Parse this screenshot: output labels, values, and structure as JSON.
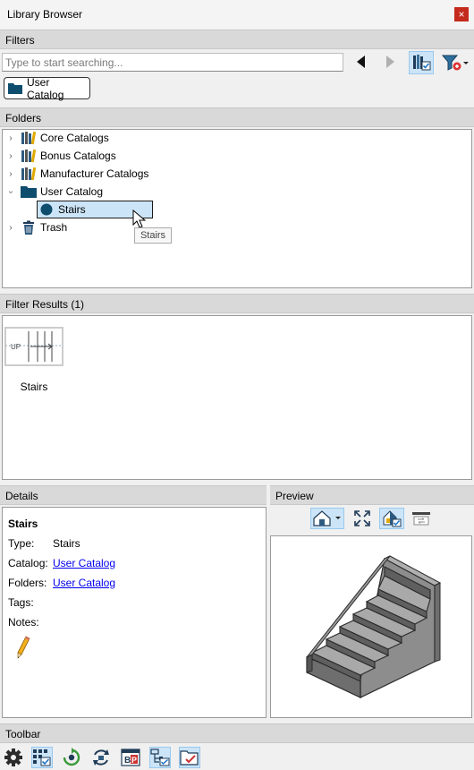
{
  "window": {
    "title": "Library Browser",
    "close_glyph": "×"
  },
  "filters": {
    "header": "Filters",
    "search_placeholder": "Type to start searching...",
    "chip_label": "User Catalog",
    "icons": [
      "back-arrow-icon",
      "forward-arrow-icon",
      "filter-catalog-icon",
      "add-filter-icon"
    ]
  },
  "folders": {
    "header": "Folders",
    "items": [
      {
        "label": "Core Catalogs",
        "icon": "catalog-books-icon",
        "expanded": false
      },
      {
        "label": "Bonus Catalogs",
        "icon": "catalog-books-icon",
        "expanded": false
      },
      {
        "label": "Manufacturer Catalogs",
        "icon": "catalog-books-icon",
        "expanded": false
      },
      {
        "label": "User Catalog",
        "icon": "folder-icon",
        "expanded": true
      },
      {
        "label": "Stairs",
        "icon": "circle-icon",
        "selected": true
      },
      {
        "label": "Trash",
        "icon": "trash-icon",
        "expanded": false
      }
    ],
    "tooltip": "Stairs"
  },
  "results": {
    "header": "Filter Results (1)",
    "item_label": "Stairs",
    "thumb_text": "UP"
  },
  "details": {
    "header": "Details",
    "name": "Stairs",
    "type_label": "Type:",
    "type_value": "Stairs",
    "catalog_label": "Catalog:",
    "catalog_value": "User Catalog",
    "folders_label": "Folders:",
    "folders_value": "User Catalog",
    "tags_label": "Tags:",
    "notes_label": "Notes:"
  },
  "preview": {
    "header": "Preview",
    "icons": [
      "view-mode-icon",
      "fit-view-icon",
      "material-view-icon",
      "toggle-view-icon"
    ]
  },
  "toolbar": {
    "header": "Toolbar",
    "icons": [
      "gear-icon",
      "grid-select-icon",
      "refresh-icon",
      "sync-icon",
      "bp-icon",
      "tree-filter-icon",
      "folder-check-icon"
    ]
  },
  "colors": {
    "accent": "#cce4f7",
    "folder": "#0e4d6e",
    "link": "#0000ee",
    "close": "#c42b1c"
  }
}
